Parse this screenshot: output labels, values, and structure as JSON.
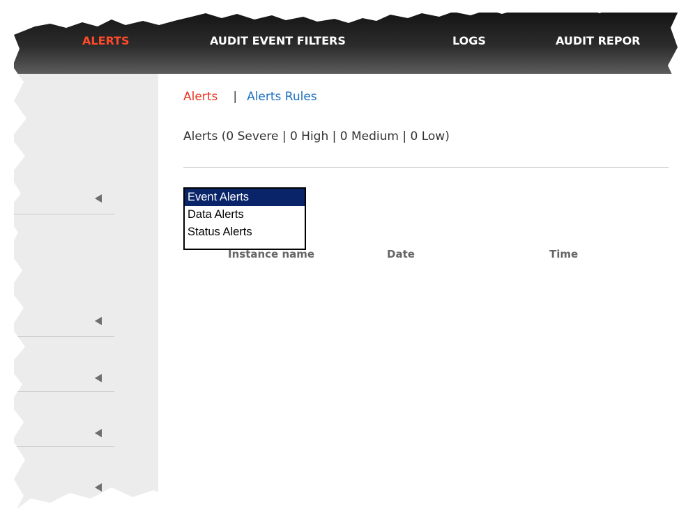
{
  "nav": {
    "items": [
      {
        "label": "ALERTS",
        "active": true
      },
      {
        "label": "AUDIT EVENT FILTERS",
        "active": false
      },
      {
        "label": "LOGS",
        "active": false
      },
      {
        "label": "AUDIT REPOR",
        "active": false
      }
    ]
  },
  "tabs": {
    "active_label": "Alerts",
    "separator": "|",
    "link_label": "Alerts Rules"
  },
  "summary": "Alerts (0 Severe | 0 High | 0 Medium | 0 Low)",
  "alert_type_list": {
    "options": [
      "Event Alerts",
      "Data Alerts",
      "Status Alerts"
    ],
    "selected": "Event Alerts"
  },
  "table": {
    "columns": [
      "Instance name",
      "Date",
      "Time"
    ]
  },
  "colors": {
    "nav_active": "#ff4a2a",
    "tab_active": "#e8321f",
    "link": "#1a6fbf",
    "selected_bg": "#0a246a"
  }
}
